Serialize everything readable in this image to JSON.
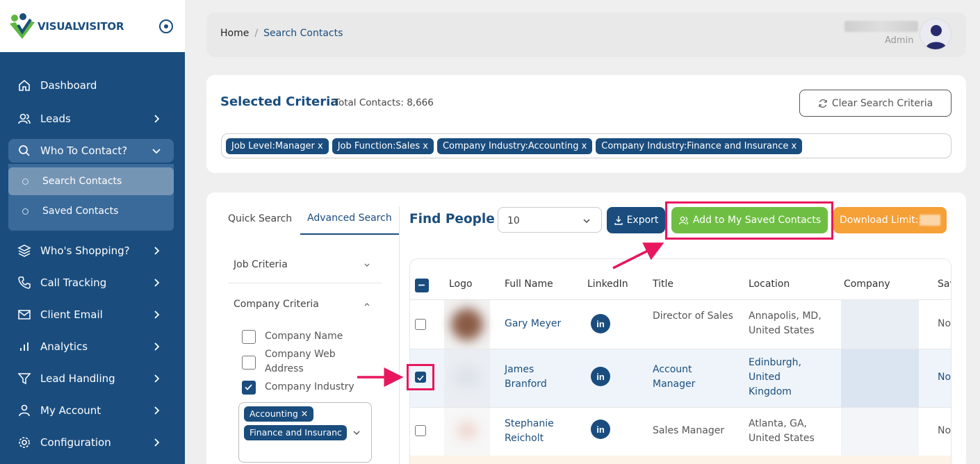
{
  "brand": {
    "name_part1": "VISUAL",
    "name_part2": "VISITOR"
  },
  "sidebar": {
    "items": [
      {
        "label": "Dashboard",
        "icon": "home-icon"
      },
      {
        "label": "Leads",
        "icon": "users-icon"
      },
      {
        "label": "Who To Contact?",
        "icon": "search-icon"
      },
      {
        "label": "Who's Shopping?",
        "icon": "layers-icon"
      },
      {
        "label": "Call Tracking",
        "icon": "phone-icon"
      },
      {
        "label": "Client Email",
        "icon": "mail-icon"
      },
      {
        "label": "Analytics",
        "icon": "bar-chart-icon"
      },
      {
        "label": "Lead Handling",
        "icon": "filter-icon"
      },
      {
        "label": "My Account",
        "icon": "user-icon"
      },
      {
        "label": "Configuration",
        "icon": "gear-icon"
      }
    ],
    "sub_items": [
      {
        "label": "Search Contacts"
      },
      {
        "label": "Saved Contacts"
      }
    ]
  },
  "header": {
    "breadcrumb_home": "Home",
    "breadcrumb_sep": "/",
    "breadcrumb_current": "Search Contacts",
    "user_role": "Admin"
  },
  "criteria": {
    "title": "Selected Criteria",
    "total_label": "Total Contacts: 8,666",
    "clear_button": "Clear Search Criteria",
    "chips": [
      "Job Level:Manager x",
      "Job Function:Sales x",
      "Company Industry:Accounting x",
      "Company Industry:Finance and Insurance x"
    ]
  },
  "filters": {
    "tab_quick": "Quick Search",
    "tab_advanced": "Advanced Search",
    "job_criteria": "Job Criteria",
    "company_criteria": "Company Criteria",
    "options": [
      {
        "label": "Company Name",
        "checked": false
      },
      {
        "label": "Company Web Address",
        "checked": false
      },
      {
        "label": "Company Industry",
        "checked": true
      }
    ],
    "industry_chips": [
      "Accounting ✕",
      "Finance and Insuranc"
    ]
  },
  "results": {
    "title": "Find People",
    "per_page": "10",
    "export_button": "Export",
    "add_button": "Add to My Saved Contacts",
    "download_limit": "Download Limit:",
    "columns": [
      "Logo",
      "Full Name",
      "LinkedIn",
      "Title",
      "Location",
      "Company",
      "Sav"
    ],
    "rows": [
      {
        "name": "Gary Meyer",
        "title": "Director of Sales",
        "location": "Annapolis, MD, United States",
        "saved": "No",
        "checked": false
      },
      {
        "name": "James Branford",
        "title": "Account Manager",
        "location": "Edinburgh, United Kingdom",
        "saved": "No",
        "checked": true
      },
      {
        "name": "Stephanie Reicholt",
        "title": "Sales Manager",
        "location": "Atlanta, GA, United States",
        "saved": "No",
        "checked": false
      }
    ],
    "linkedin_glyph": "in"
  },
  "colors": {
    "primary": "#1a4d7e",
    "green": "#6fbe44",
    "orange": "#f6a038",
    "highlight": "#e8175d"
  }
}
